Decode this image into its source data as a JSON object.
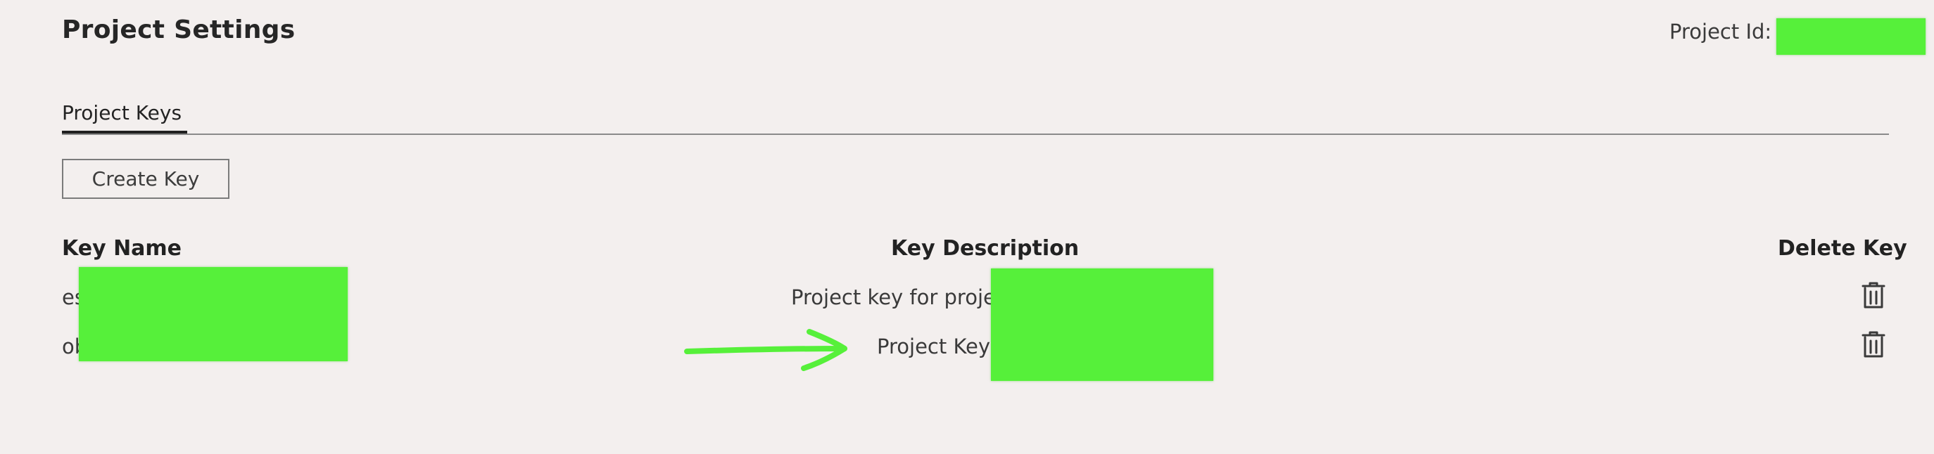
{
  "header": {
    "title": "Project Settings",
    "project_id_label": "Project Id:"
  },
  "tabs": [
    {
      "label": "Project Keys",
      "active": true
    }
  ],
  "actions": {
    "create_key_label": "Create Key"
  },
  "table": {
    "columns": [
      "Key Name",
      "Key Description",
      "Delete Key"
    ],
    "rows": [
      {
        "key_name": "es",
        "description": "Project key for proje"
      },
      {
        "key_name": "ob",
        "description": "Project Key"
      }
    ]
  },
  "icons": {
    "delete": "trash-icon"
  },
  "colors": {
    "background": "#f3efee",
    "redaction": "#56f03a",
    "annotation_arrow": "#56f03a"
  }
}
